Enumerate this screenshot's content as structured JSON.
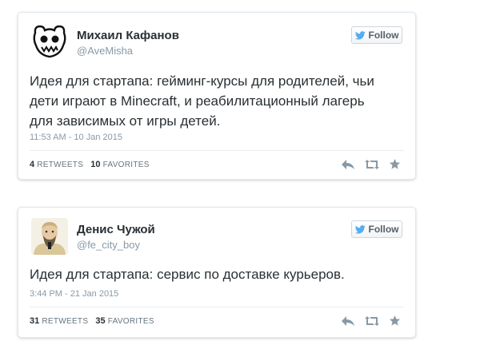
{
  "tweets": [
    {
      "display_name": "Михаил Кафанов",
      "handle": "@AveMisha",
      "follow_label": "Follow",
      "text_lines": [
        "Идея для стартапа: гейминг-курсы для родителей, чьи",
        "дети играют в Minecraft, и реабилитационный лагерь",
        "для зависимых от игры детей."
      ],
      "timestamp": "11:53 AM - 10 Jan 2015",
      "retweets_count": "4",
      "retweets_label": "RETWEETS",
      "favorites_count": "10",
      "favorites_label": "FAVORITES",
      "avatar_icon": "bear-logo-icon"
    },
    {
      "display_name": "Денис Чужой",
      "handle": "@fe_city_boy",
      "follow_label": "Follow",
      "text_lines": [
        "Идея для стартапа: сервис по доставке курьеров."
      ],
      "timestamp": "3:44 PM - 21 Jan 2015",
      "retweets_count": "31",
      "retweets_label": "RETWEETS",
      "favorites_count": "35",
      "favorites_label": "FAVORITES",
      "avatar_icon": "person-portrait-icon"
    }
  ],
  "colors": {
    "twitter_blue": "#55acee",
    "action_gray": "#8899a6",
    "text": "#292f33"
  },
  "icons": [
    "reply-icon",
    "retweet-icon",
    "favorite-star-icon",
    "twitter-bird-icon"
  ]
}
